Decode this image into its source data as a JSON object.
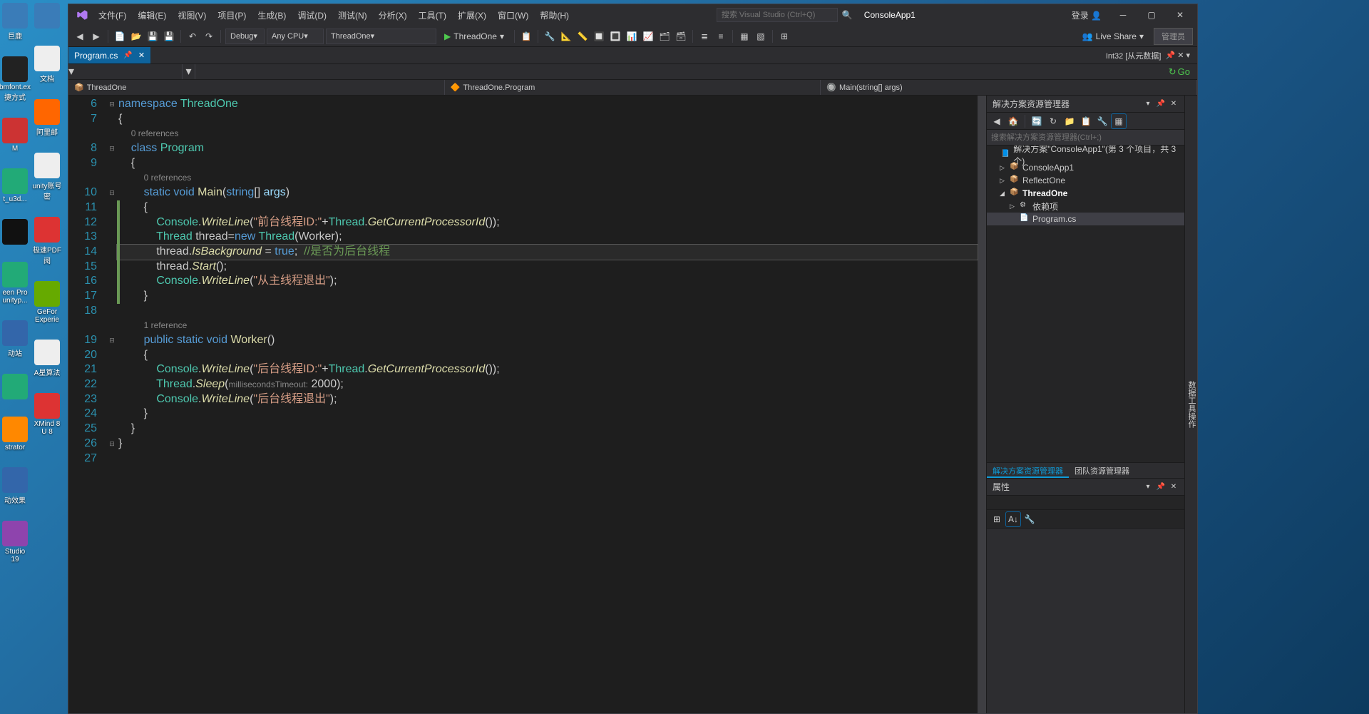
{
  "desktop": {
    "icons_left": [
      {
        "label": "巨鹿",
        "color": "#3a7cb8"
      },
      {
        "label": "bmfont.ex 捷方式",
        "color": "#222"
      },
      {
        "label": "M",
        "color": "#c33"
      },
      {
        "label": "t_u3d...",
        "color": "#2a7"
      },
      {
        "label": "",
        "color": "#111"
      },
      {
        "label": "een Pro unityp...",
        "color": "#2a7"
      },
      {
        "label": "动站",
        "color": "#36a"
      },
      {
        "label": "",
        "color": "#2a7"
      },
      {
        "label": "strator",
        "color": "#f80"
      },
      {
        "label": "动效果",
        "color": "#36a"
      },
      {
        "label": "Studio 19",
        "color": "#8e44ad"
      }
    ],
    "icons_right": [
      {
        "label": "",
        "color": "#3a7cb8"
      },
      {
        "label": "文档",
        "color": "#eee"
      },
      {
        "label": "阿里邮",
        "color": "#f60"
      },
      {
        "label": "unity账号密",
        "color": "#eee"
      },
      {
        "label": "极速PDF阅",
        "color": "#d33"
      },
      {
        "label": "GeFor Experie",
        "color": "#6a0"
      },
      {
        "label": "A星算法",
        "color": "#eee"
      },
      {
        "label": "XMind 8 U 8",
        "color": "#d33"
      }
    ]
  },
  "vs": {
    "menus": [
      "文件(F)",
      "编辑(E)",
      "视图(V)",
      "项目(P)",
      "生成(B)",
      "调试(D)",
      "测试(N)",
      "分析(X)",
      "工具(T)",
      "扩展(X)",
      "窗口(W)",
      "帮助(H)"
    ],
    "search_placeholder": "搜索 Visual Studio (Ctrl+Q)",
    "app_name": "ConsoleApp1",
    "login": "登录",
    "admin": "管理员",
    "toolbar": {
      "debug": "Debug",
      "anycpu": "Any CPU",
      "target": "ThreadOne",
      "start": "ThreadOne",
      "liveshare": "Live Share"
    },
    "tab": {
      "name": "Program.cs"
    },
    "meta_tab": "Int32 [从元数据]",
    "go": "Go",
    "breadcrumb": {
      "project": "ThreadOne",
      "class": "ThreadOne.Program",
      "method": "Main(string[] args)"
    },
    "editor": {
      "lines": [
        {
          "n": 6,
          "fold": "⊟",
          "html": "<span class='kw'>namespace</span> <span class='cls'>ThreadOne</span>"
        },
        {
          "n": 7,
          "html": "{"
        },
        {
          "n": "",
          "html": "    <span class='ref'>0 references</span>"
        },
        {
          "n": 8,
          "fold": "⊟",
          "html": "    <span class='kw'>class</span> <span class='cls'>Program</span>"
        },
        {
          "n": 9,
          "html": "    {"
        },
        {
          "n": "",
          "html": "        <span class='ref'>0 references</span>"
        },
        {
          "n": 10,
          "fold": "⊟",
          "html": "        <span class='kw'>static</span> <span class='kw'>void</span> <span class='meth2'>Main</span>(<span class='kw'>string</span>[] <span class='param'>args</span>)"
        },
        {
          "n": 11,
          "html": "        {",
          "mark": true
        },
        {
          "n": 12,
          "html": "            <span class='cls'>Console</span>.<span class='meth'>WriteLine</span>(<span class='str'>\"前台线程ID:\"</span>+<span class='cls'>Thread</span>.<span class='meth'>GetCurrentProcessorId</span>());",
          "mark": true
        },
        {
          "n": 13,
          "html": "            <span class='cls'>Thread</span> <span class='var'>thread</span>=<span class='kw'>new</span> <span class='cls'>Thread</span>(<span class='var'>Worker</span>);",
          "mark": true
        },
        {
          "n": 14,
          "hl": true,
          "html": "            <span class='var'>thread</span>.<span class='meth'>IsBackground</span> = <span class='boolv'>true</span>;  <span class='cmt'>//是否为后台线程</span>",
          "mark": true
        },
        {
          "n": 15,
          "html": "            <span class='var'>thread</span>.<span class='meth'>Start</span>();",
          "mark": true
        },
        {
          "n": 16,
          "html": "            <span class='cls'>Console</span>.<span class='meth'>WriteLine</span>(<span class='str'>\"从主线程退出\"</span>);",
          "mark": true
        },
        {
          "n": 17,
          "html": "        }",
          "mark": true
        },
        {
          "n": 18,
          "html": ""
        },
        {
          "n": "",
          "html": "        <span class='ref'>1 reference</span>"
        },
        {
          "n": 19,
          "fold": "⊟",
          "html": "        <span class='kw'>public</span> <span class='kw'>static</span> <span class='kw'>void</span> <span class='meth2'>Worker</span>()"
        },
        {
          "n": 20,
          "html": "        {"
        },
        {
          "n": 21,
          "html": "            <span class='cls'>Console</span>.<span class='meth'>WriteLine</span>(<span class='str'>\"后台线程ID:\"</span>+<span class='cls'>Thread</span>.<span class='meth'>GetCurrentProcessorId</span>());"
        },
        {
          "n": 22,
          "html": "            <span class='cls'>Thread</span>.<span class='meth'>Sleep</span>(<span class='pale'>millisecondsTimeout:</span> 2000);"
        },
        {
          "n": 23,
          "html": "            <span class='cls'>Console</span>.<span class='meth'>WriteLine</span>(<span class='str'>\"后台线程退出\"</span>);"
        },
        {
          "n": 24,
          "html": "        }"
        },
        {
          "n": 25,
          "html": "    }"
        },
        {
          "n": 26,
          "fold": "⊟",
          "html": "}"
        },
        {
          "n": 27,
          "html": ""
        }
      ]
    },
    "solution_explorer": {
      "title": "解决方案资源管理器",
      "search_placeholder": "搜索解决方案资源管理器(Ctrl+;)",
      "solution": "解决方案\"ConsoleApp1\"(第 3 个项目，共 3 个)",
      "nodes": [
        {
          "indent": 1,
          "exp": "▷",
          "label": "ConsoleApp1",
          "ico": "📦"
        },
        {
          "indent": 1,
          "exp": "▷",
          "label": "ReflectOne",
          "ico": "📦"
        },
        {
          "indent": 1,
          "exp": "◢",
          "label": "ThreadOne",
          "ico": "📦",
          "bold": true
        },
        {
          "indent": 2,
          "exp": "▷",
          "label": "依赖项",
          "ico": "⚙"
        },
        {
          "indent": 2,
          "exp": "",
          "label": "Program.cs",
          "ico": "📄",
          "sel": true
        }
      ],
      "tabs": [
        "解决方案资源管理器",
        "团队资源管理器"
      ]
    },
    "properties": {
      "title": "属性"
    },
    "vertical_tab": "数据工具操作"
  }
}
